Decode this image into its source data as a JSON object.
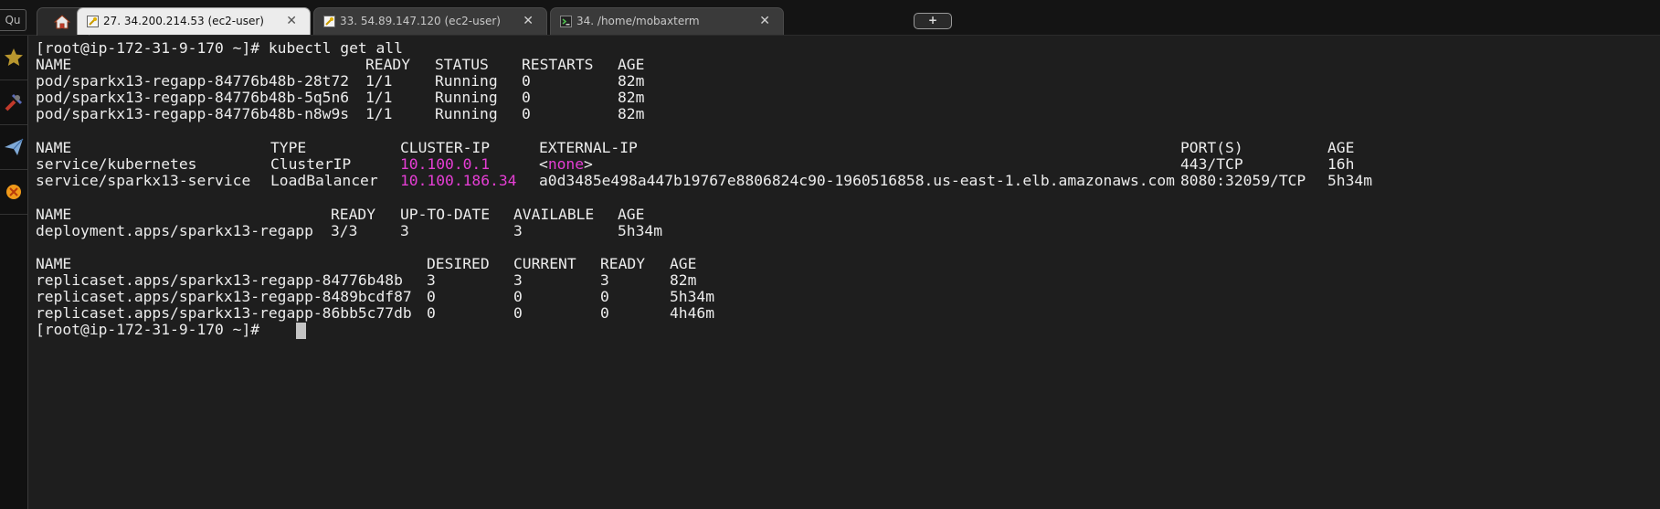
{
  "search_box": {
    "text": "Qu"
  },
  "tabs": [
    {
      "label": "27. 34.200.214.53 (ec2-user)",
      "active": true,
      "icon": "key-icon",
      "close": "✕"
    },
    {
      "label": "33. 54.89.147.120 (ec2-user)",
      "active": false,
      "icon": "key-icon",
      "close": "✕"
    },
    {
      "label": "34. /home/mobaxterm",
      "active": false,
      "icon": "terminal-icon",
      "close": "✕"
    }
  ],
  "new_tab_label": "+",
  "sidebar": [
    "star-icon",
    "tools-icon",
    "send-icon",
    "xserver-icon"
  ],
  "terminal": {
    "prompt1": "[root@ip-172-31-9-170 ~]# kubectl get all",
    "pods": {
      "headers": [
        "NAME",
        "READY",
        "STATUS",
        "RESTARTS",
        "AGE"
      ],
      "rows": [
        [
          "pod/sparkx13-regapp-84776b48b-28t72",
          "1/1",
          "Running",
          "0",
          "82m"
        ],
        [
          "pod/sparkx13-regapp-84776b48b-5q5n6",
          "1/1",
          "Running",
          "0",
          "82m"
        ],
        [
          "pod/sparkx13-regapp-84776b48b-n8w9s",
          "1/1",
          "Running",
          "0",
          "82m"
        ]
      ]
    },
    "services": {
      "headers": [
        "NAME",
        "TYPE",
        "CLUSTER-IP",
        "EXTERNAL-IP",
        "PORT(S)",
        "AGE"
      ],
      "rows": [
        [
          "service/kubernetes",
          "ClusterIP",
          "10.100.0.1",
          "<",
          "none",
          ">",
          "443/TCP",
          "16h"
        ],
        [
          "service/sparkx13-service",
          "LoadBalancer",
          "10.100.186.34",
          "a0d3485e498a447b19767e8806824c90-1960516858.us-east-1.elb.amazonaws.com",
          "8080:32059/TCP",
          "5h34m"
        ]
      ]
    },
    "deployments": {
      "headers": [
        "NAME",
        "READY",
        "UP-TO-DATE",
        "AVAILABLE",
        "AGE"
      ],
      "rows": [
        [
          "deployment.apps/sparkx13-regapp",
          "3/3",
          "3",
          "3",
          "5h34m"
        ]
      ]
    },
    "replicasets": {
      "headers": [
        "NAME",
        "DESIRED",
        "CURRENT",
        "READY",
        "AGE"
      ],
      "rows": [
        [
          "replicaset.apps/sparkx13-regapp-84776b48b",
          "3",
          "3",
          "3",
          "82m"
        ],
        [
          "replicaset.apps/sparkx13-regapp-8489bcdf87",
          "0",
          "0",
          "0",
          "5h34m"
        ],
        [
          "replicaset.apps/sparkx13-regapp-86bb5c77db",
          "0",
          "0",
          "0",
          "4h46m"
        ]
      ]
    },
    "prompt2": "[root@ip-172-31-9-170 ~]#"
  },
  "colors": {
    "background": "#1e1e1e",
    "text": "#ececec",
    "ip_highlight": "#e53ed4"
  }
}
